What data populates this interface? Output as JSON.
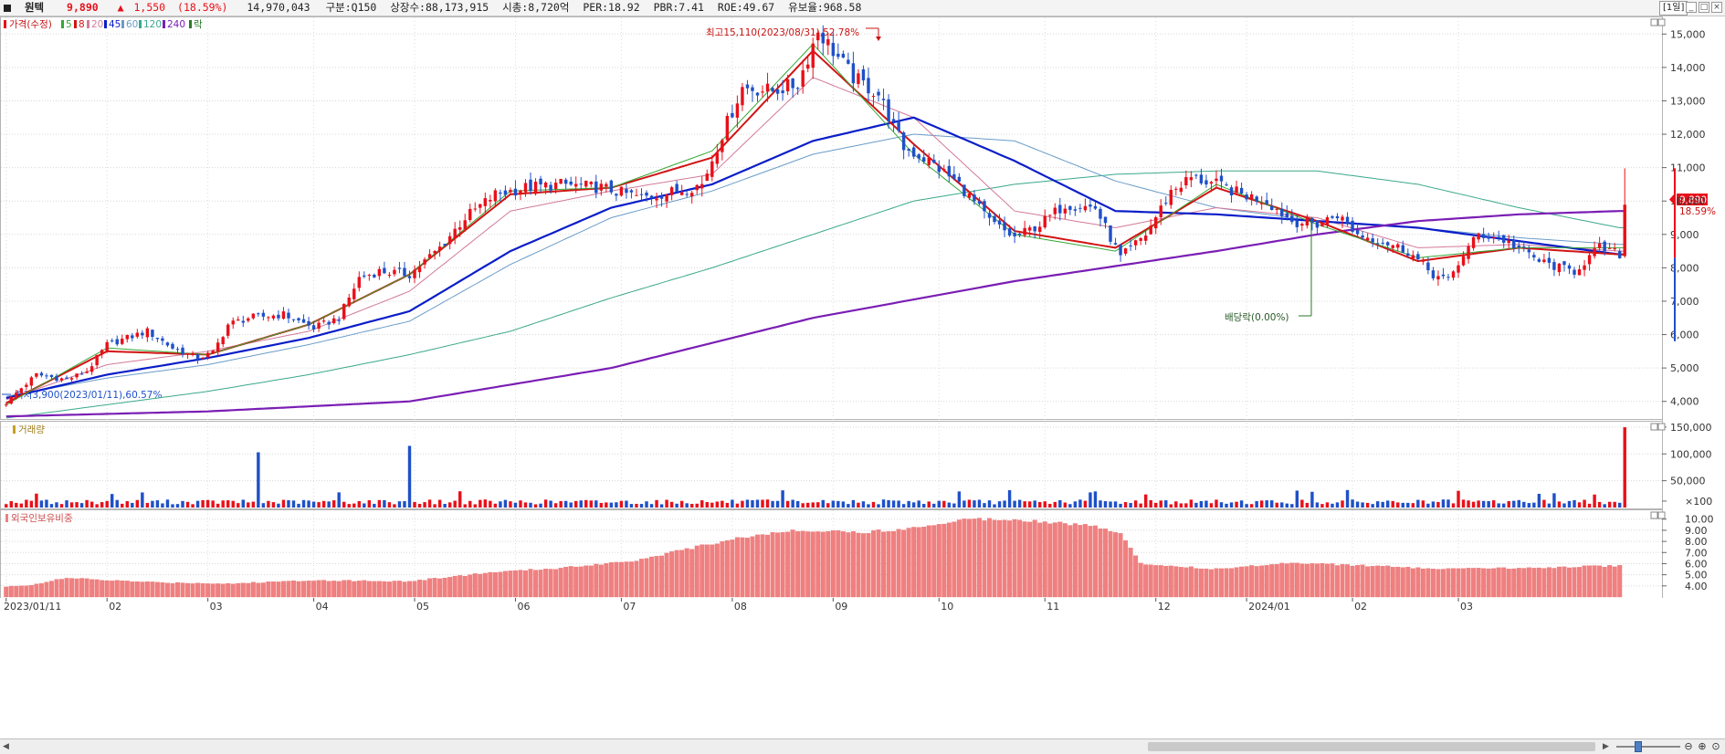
{
  "header": {
    "name": "원텍",
    "price": "9,890",
    "change_arrow": "▲",
    "change": "1,550",
    "change_pct": "(18.59%)",
    "volume": "14,970,043",
    "division": "구분:Q150",
    "listed_shares": "상장수:88,173,915",
    "market_cap": "시총:8,720억",
    "per": "PER:18.92",
    "pbr": "PBR:7.41",
    "roe": "ROE:49.67",
    "reserve_ratio": "유보율:968.58",
    "period": "[1일]",
    "buttons": [
      "_",
      "□",
      "×"
    ]
  },
  "legend": {
    "price_label": "가격(수정)",
    "ma_labels": [
      "5",
      "8",
      "20",
      "45",
      "60",
      "120",
      "240"
    ],
    "ex_div_label": "락",
    "volume_label": "거래량",
    "foreign_label": "외국인보유비중"
  },
  "colors": {
    "up": "#e8101a",
    "down": "#1e50c8",
    "ma5": "#35a835",
    "ma8": "#d21414",
    "ma20": "#d27a9a",
    "ma45": "#0a1ec8",
    "ma60": "#6a9cc8",
    "ma120": "#3aa88a",
    "ma240": "#7a1eb4",
    "foreign_bar": "#f08080",
    "annotation_high": "#c81414",
    "annotation_low": "#1e50c8",
    "annotation_div": "#2a7a2a"
  },
  "annotations": {
    "high": "최고15,110(2023/08/31),52.78%",
    "low": "최저3,900(2023/01/11),60.57%",
    "dividend": "배당락(0.00%)",
    "price_tag": "9,890",
    "pct_tag": "18.59%"
  },
  "chart_data": [
    {
      "type": "candlestick",
      "title": "가격(수정)",
      "y_ticks": [
        "15,000",
        "14,000",
        "13,000",
        "12,000",
        "11,000",
        "10,000",
        "9,000",
        "8,000",
        "7,000",
        "6,000",
        "5,000",
        "4,000"
      ],
      "ylim": [
        3500,
        15500
      ],
      "x_ticks": [
        "2023/01/11",
        "02",
        "03",
        "04",
        "05",
        "06",
        "07",
        "08",
        "09",
        "10",
        "11",
        "12",
        "2024/01",
        "02",
        "03"
      ],
      "close_keyframes": [
        [
          0,
          3950
        ],
        [
          3,
          4400
        ],
        [
          6,
          4800
        ],
        [
          12,
          4650
        ],
        [
          16,
          4900
        ],
        [
          20,
          5700
        ],
        [
          24,
          5900
        ],
        [
          28,
          6100
        ],
        [
          33,
          5600
        ],
        [
          38,
          5300
        ],
        [
          41,
          5450
        ],
        [
          44,
          6300
        ],
        [
          48,
          6500
        ],
        [
          55,
          6600
        ],
        [
          61,
          6200
        ],
        [
          66,
          6500
        ],
        [
          70,
          7700
        ],
        [
          74,
          7900
        ],
        [
          80,
          7800
        ],
        [
          86,
          8600
        ],
        [
          91,
          9500
        ],
        [
          97,
          10200
        ],
        [
          103,
          10400
        ],
        [
          110,
          10500
        ],
        [
          118,
          10400
        ],
        [
          126,
          10100
        ],
        [
          133,
          10300
        ],
        [
          138,
          10500
        ],
        [
          142,
          12000
        ],
        [
          146,
          13400
        ],
        [
          152,
          13300
        ],
        [
          157,
          13500
        ],
        [
          161,
          15110
        ],
        [
          164,
          14500
        ],
        [
          168,
          13700
        ],
        [
          173,
          13200
        ],
        [
          178,
          11600
        ],
        [
          183,
          11200
        ],
        [
          189,
          10500
        ],
        [
          195,
          9400
        ],
        [
          200,
          8900
        ],
        [
          205,
          9300
        ],
        [
          210,
          9900
        ],
        [
          216,
          9800
        ],
        [
          221,
          8300
        ],
        [
          226,
          9000
        ],
        [
          231,
          10300
        ],
        [
          235,
          10700
        ],
        [
          240,
          10500
        ],
        [
          245,
          10200
        ],
        [
          250,
          10000
        ],
        [
          255,
          9400
        ],
        [
          260,
          9300
        ],
        [
          264,
          9600
        ],
        [
          268,
          9000
        ],
        [
          273,
          8800
        ],
        [
          278,
          8500
        ],
        [
          283,
          7800
        ],
        [
          286,
          7600
        ],
        [
          289,
          8400
        ],
        [
          292,
          9000
        ],
        [
          296,
          8900
        ],
        [
          300,
          8600
        ],
        [
          304,
          8200
        ],
        [
          308,
          8000
        ],
        [
          311,
          7900
        ],
        [
          316,
          8600
        ],
        [
          320,
          8400
        ],
        [
          321,
          9890
        ]
      ],
      "series": [
        {
          "name": "5",
          "sample": [
            [
              0,
              3900
            ],
            [
              20,
              5600
            ],
            [
              40,
              5400
            ],
            [
              60,
              6300
            ],
            [
              80,
              7800
            ],
            [
              100,
              10300
            ],
            [
              120,
              10400
            ],
            [
              140,
              11500
            ],
            [
              160,
              14700
            ],
            [
              180,
              11400
            ],
            [
              200,
              9000
            ],
            [
              220,
              8500
            ],
            [
              240,
              10500
            ],
            [
              260,
              9300
            ],
            [
              280,
              8300
            ],
            [
              300,
              8600
            ],
            [
              320,
              8600
            ]
          ]
        },
        {
          "name": "8",
          "sample": [
            [
              0,
              3950
            ],
            [
              20,
              5500
            ],
            [
              40,
              5400
            ],
            [
              60,
              6300
            ],
            [
              80,
              7800
            ],
            [
              100,
              10200
            ],
            [
              120,
              10400
            ],
            [
              140,
              11300
            ],
            [
              160,
              14500
            ],
            [
              180,
              11700
            ],
            [
              200,
              9100
            ],
            [
              220,
              8600
            ],
            [
              240,
              10400
            ],
            [
              260,
              9400
            ],
            [
              280,
              8200
            ],
            [
              300,
              8600
            ],
            [
              320,
              8400
            ]
          ]
        },
        {
          "name": "20",
          "sample": [
            [
              0,
              4050
            ],
            [
              20,
              5100
            ],
            [
              40,
              5500
            ],
            [
              60,
              6100
            ],
            [
              80,
              7300
            ],
            [
              100,
              9700
            ],
            [
              120,
              10300
            ],
            [
              140,
              10800
            ],
            [
              160,
              13700
            ],
            [
              180,
              12500
            ],
            [
              200,
              9700
            ],
            [
              220,
              9200
            ],
            [
              240,
              9800
            ],
            [
              260,
              9500
            ],
            [
              280,
              8600
            ],
            [
              300,
              8700
            ],
            [
              320,
              8500
            ]
          ]
        },
        {
          "name": "45",
          "sample": [
            [
              0,
              4100
            ],
            [
              20,
              4800
            ],
            [
              40,
              5300
            ],
            [
              60,
              5900
            ],
            [
              80,
              6700
            ],
            [
              100,
              8500
            ],
            [
              120,
              9800
            ],
            [
              140,
              10500
            ],
            [
              160,
              11800
            ],
            [
              180,
              12500
            ],
            [
              200,
              11200
            ],
            [
              220,
              9700
            ],
            [
              240,
              9600
            ],
            [
              260,
              9400
            ],
            [
              280,
              9200
            ],
            [
              300,
              8800
            ],
            [
              320,
              8400
            ]
          ]
        },
        {
          "name": "60",
          "sample": [
            [
              0,
              4150
            ],
            [
              20,
              4700
            ],
            [
              40,
              5100
            ],
            [
              60,
              5700
            ],
            [
              80,
              6400
            ],
            [
              100,
              8100
            ],
            [
              120,
              9500
            ],
            [
              140,
              10300
            ],
            [
              160,
              11400
            ],
            [
              180,
              12000
            ],
            [
              200,
              11800
            ],
            [
              220,
              10600
            ],
            [
              240,
              9800
            ],
            [
              260,
              9400
            ],
            [
              280,
              9200
            ],
            [
              300,
              8900
            ],
            [
              320,
              8700
            ]
          ]
        },
        {
          "name": "120",
          "sample": [
            [
              0,
              3500
            ],
            [
              20,
              3900
            ],
            [
              40,
              4300
            ],
            [
              60,
              4800
            ],
            [
              80,
              5400
            ],
            [
              100,
              6100
            ],
            [
              120,
              7100
            ],
            [
              140,
              8000
            ],
            [
              160,
              9000
            ],
            [
              180,
              10000
            ],
            [
              200,
              10500
            ],
            [
              220,
              10800
            ],
            [
              240,
              10900
            ],
            [
              260,
              10900
            ],
            [
              280,
              10500
            ],
            [
              300,
              9800
            ],
            [
              320,
              9200
            ]
          ]
        },
        {
          "name": "240",
          "sample": [
            [
              0,
              3550
            ],
            [
              40,
              3700
            ],
            [
              80,
              4000
            ],
            [
              120,
              5000
            ],
            [
              160,
              6500
            ],
            [
              200,
              7600
            ],
            [
              240,
              8500
            ],
            [
              260,
              9000
            ],
            [
              280,
              9400
            ],
            [
              300,
              9600
            ],
            [
              320,
              9700
            ]
          ]
        }
      ]
    },
    {
      "type": "bar",
      "title": "거래량",
      "y_ticks": [
        "150,000",
        "100,000",
        "50,000",
        "×100"
      ],
      "ylim": [
        0,
        160000
      ],
      "spikes": [
        [
          50,
          103000
        ],
        [
          80,
          115000
        ],
        [
          321,
          149700
        ]
      ]
    },
    {
      "type": "bar",
      "title": "외국인보유비중",
      "y_ticks": [
        "10.00",
        "9.00",
        "8.00",
        "7.00",
        "6.00",
        "5.00",
        "4.00"
      ],
      "ylim": [
        3.0,
        10.8
      ],
      "keyframes": [
        [
          0,
          3.9
        ],
        [
          5,
          4.1
        ],
        [
          12,
          4.7
        ],
        [
          20,
          4.5
        ],
        [
          30,
          4.3
        ],
        [
          45,
          4.2
        ],
        [
          60,
          4.5
        ],
        [
          80,
          4.4
        ],
        [
          96,
          5.2
        ],
        [
          110,
          5.6
        ],
        [
          125,
          6.3
        ],
        [
          135,
          7.3
        ],
        [
          145,
          8.3
        ],
        [
          155,
          8.9
        ],
        [
          160,
          9.0
        ],
        [
          170,
          8.8
        ],
        [
          180,
          9.2
        ],
        [
          190,
          10.0
        ],
        [
          200,
          10.0
        ],
        [
          215,
          9.4
        ],
        [
          221,
          8.8
        ],
        [
          225,
          6.0
        ],
        [
          240,
          5.5
        ],
        [
          255,
          6.1
        ],
        [
          270,
          5.8
        ],
        [
          285,
          5.5
        ],
        [
          300,
          5.6
        ],
        [
          320,
          5.8
        ]
      ]
    }
  ]
}
